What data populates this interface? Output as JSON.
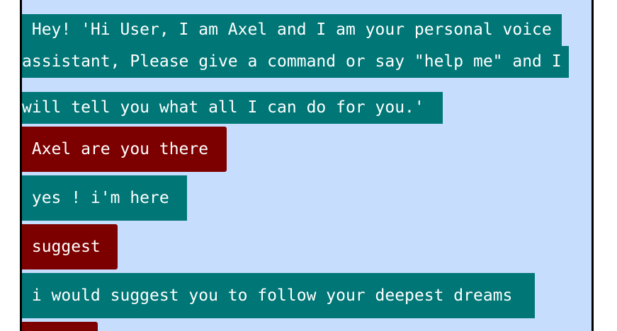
{
  "chat": {
    "welcome": {
      "line1": " Hey! 'Hi User, I am Axel and I am your personal voice",
      "line2": "assistant, Please give a command or say \"help me\" and I",
      "line3": "will tell you what all I can do for you.'"
    },
    "messages": [
      {
        "sender": "user",
        "text": " Axel are you there "
      },
      {
        "sender": "bot",
        "text": " yes ! i'm here "
      },
      {
        "sender": "user",
        "text": " suggest "
      },
      {
        "sender": "bot",
        "text": " i would suggest you to follow your deepest dreams "
      },
      {
        "sender": "user",
        "text": ""
      }
    ]
  },
  "colors": {
    "panel_bg": "#c6ddfd",
    "bot_bubble": "#007676",
    "user_bubble": "#7d0000",
    "text": "#ffffff"
  }
}
